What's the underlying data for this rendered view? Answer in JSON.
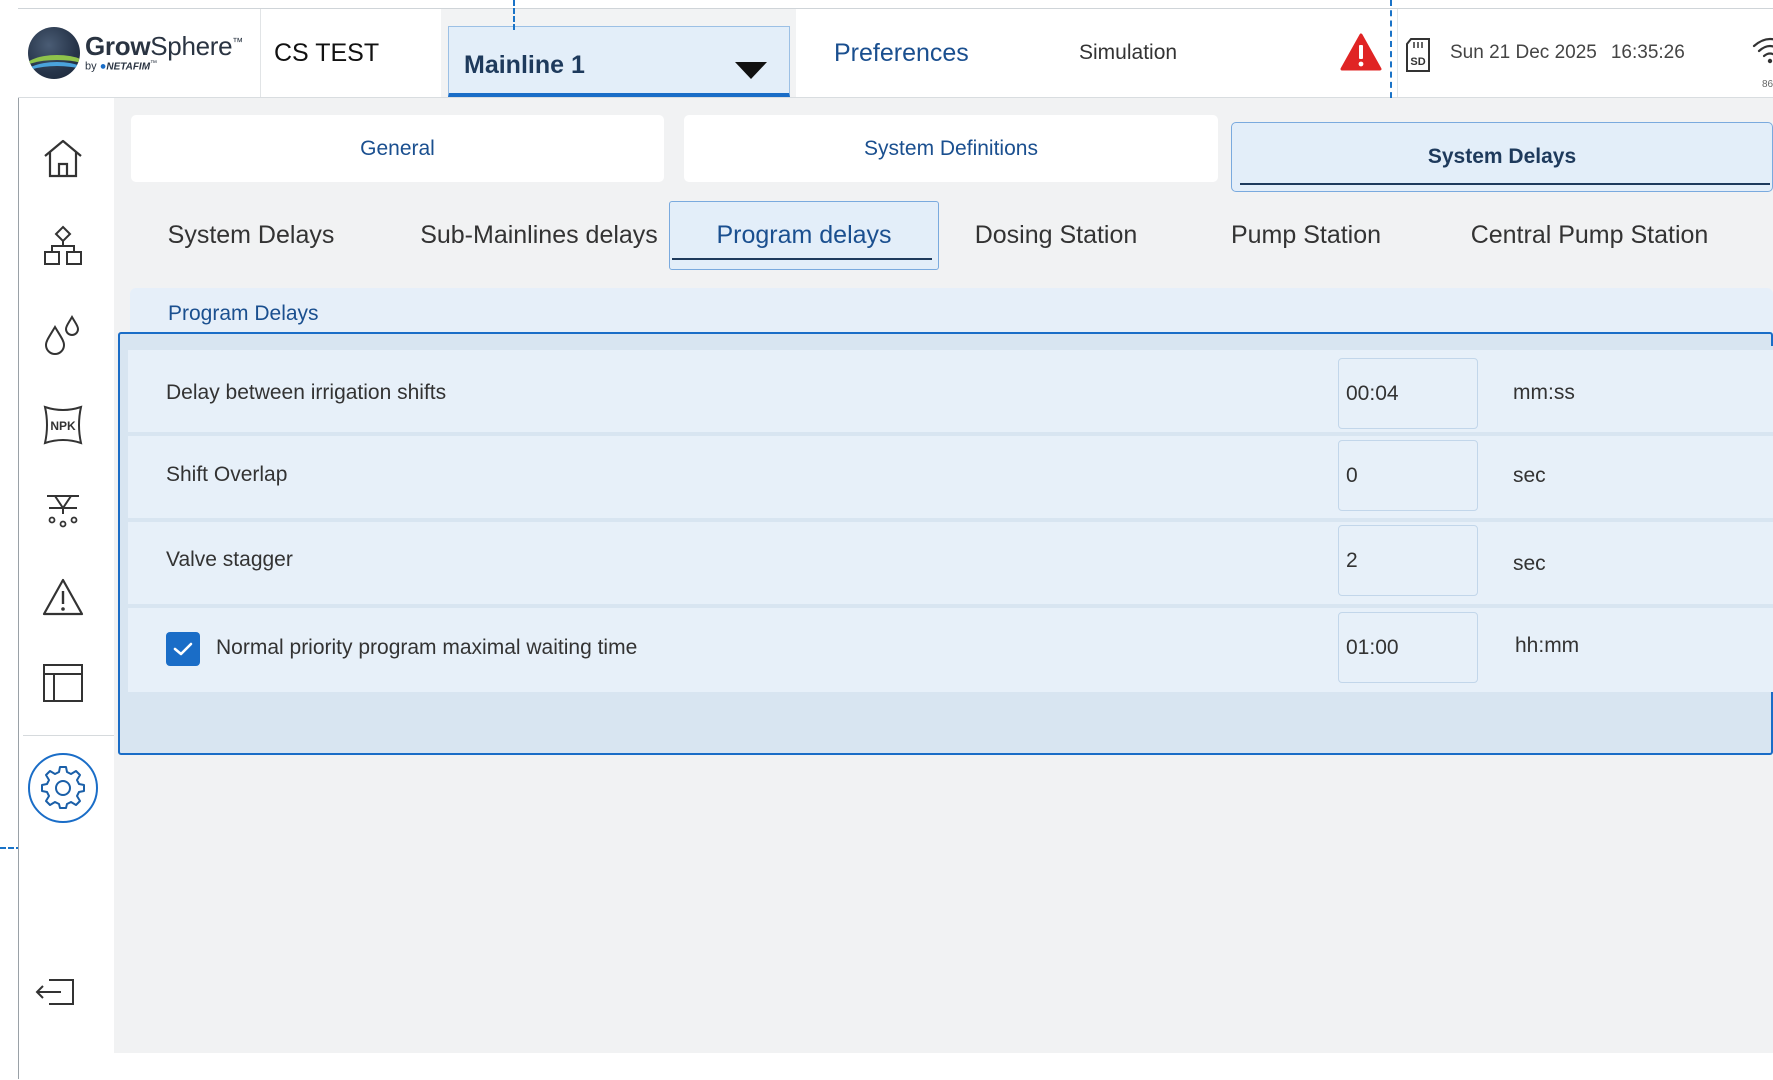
{
  "header": {
    "logo": {
      "brand_bold": "Grow",
      "brand_light": "Sphere",
      "tm": "™",
      "by": "by",
      "sub_brand": "NETAFIM",
      "sub_tm": "™"
    },
    "site_name": "CS TEST",
    "mainline": {
      "label": "Mainline 1"
    },
    "preferences_label": "Preferences",
    "simulation_label": "Simulation",
    "sd_label": "SD",
    "date": "Sun 21 Dec 2025",
    "time": "16:35:26",
    "wifi_value": "86",
    "colors": {
      "alert": "#e02424",
      "accent": "#1a6dc7"
    }
  },
  "sidebar": {
    "items": [
      {
        "name": "home",
        "icon": "home-icon"
      },
      {
        "name": "irrigation-network",
        "icon": "network-icon"
      },
      {
        "name": "water",
        "icon": "water-drops-icon"
      },
      {
        "name": "fertigation",
        "icon": "npk-bag-icon",
        "label": "NPK"
      },
      {
        "name": "irrigation-valves",
        "icon": "sprinkler-icon"
      },
      {
        "name": "alarms",
        "icon": "warning-icon"
      },
      {
        "name": "reports",
        "icon": "table-layout-icon"
      },
      {
        "name": "settings",
        "icon": "gear-icon",
        "active": true
      },
      {
        "name": "logout",
        "icon": "logout-icon"
      }
    ]
  },
  "tabs_primary": [
    {
      "label": "General",
      "active": false
    },
    {
      "label": "System Definitions",
      "active": false
    },
    {
      "label": "System Delays",
      "active": true
    }
  ],
  "tabs_secondary": [
    {
      "label": "System Delays",
      "active": false
    },
    {
      "label": "Sub-Mainlines delays",
      "active": false
    },
    {
      "label": "Program delays",
      "active": true
    },
    {
      "label": "Dosing Station",
      "active": false
    },
    {
      "label": "Pump Station",
      "active": false
    },
    {
      "label": "Central Pump Station",
      "active": false
    }
  ],
  "section": {
    "title": "Program Delays",
    "rows": [
      {
        "label": "Delay between irrigation shifts",
        "value": "00:04",
        "unit": "mm:ss"
      },
      {
        "label": "Shift Overlap",
        "value": "0",
        "unit": "sec"
      },
      {
        "label": "Valve stagger",
        "value": "2",
        "unit": "sec"
      },
      {
        "label": "Normal priority program maximal waiting time",
        "value": "01:00",
        "unit": "hh:mm",
        "checked": true
      }
    ]
  }
}
